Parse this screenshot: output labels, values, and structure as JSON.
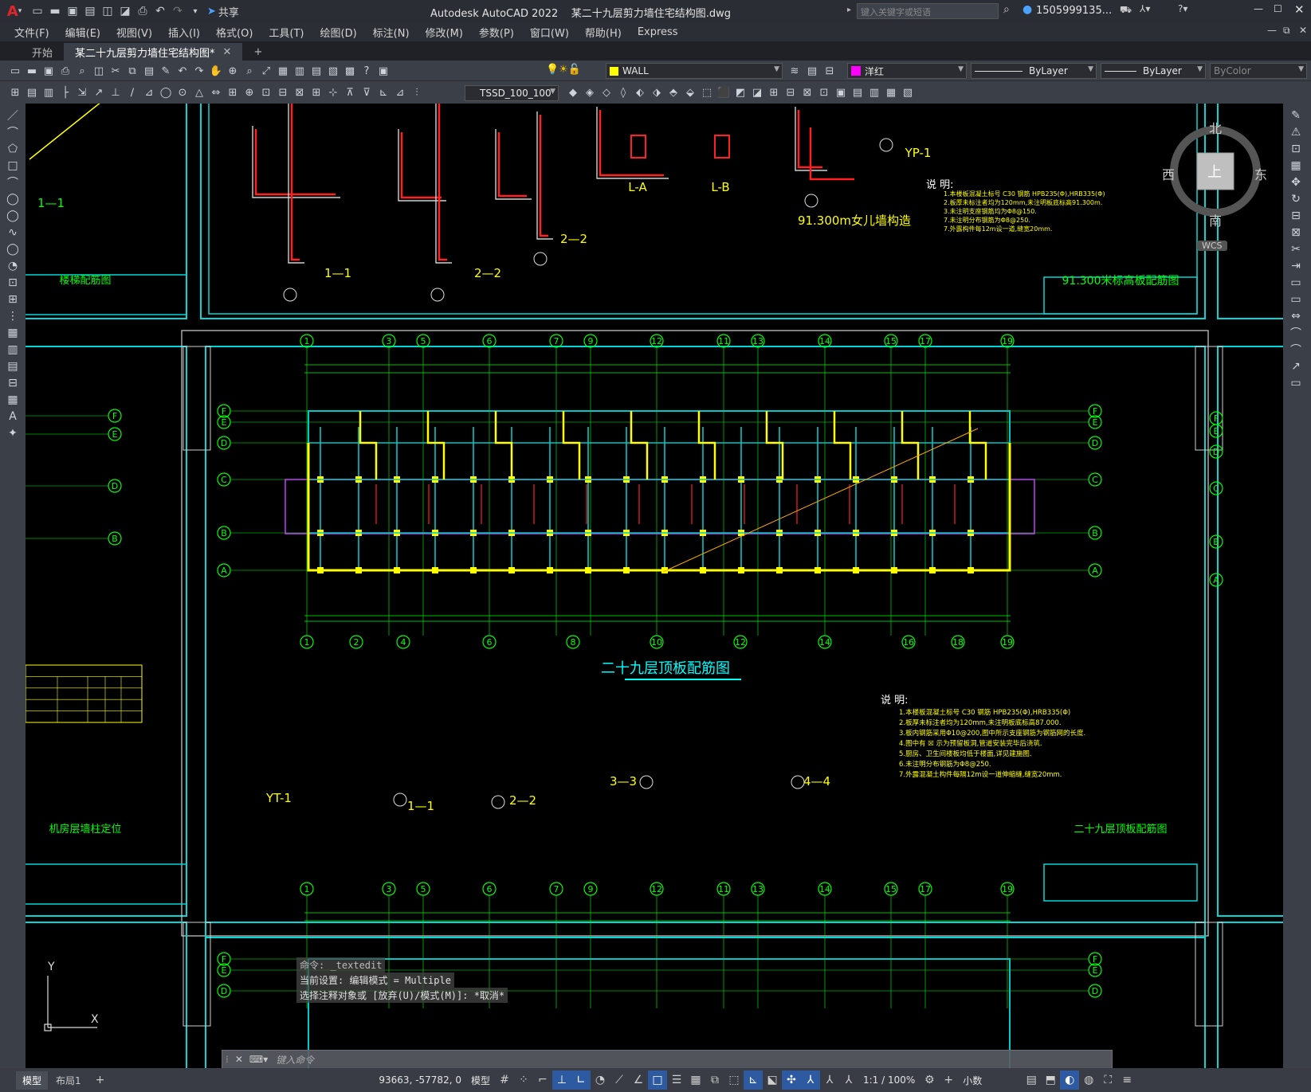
{
  "titlebar": {
    "app_title": "Autodesk AutoCAD 2022",
    "file_title": "某二十九层剪力墙住宅结构图.dwg",
    "search_placeholder": "键入关键字或短语",
    "user": "1505999135...",
    "share": "共享"
  },
  "menu": [
    "文件(F)",
    "编辑(E)",
    "视图(V)",
    "插入(I)",
    "格式(O)",
    "工具(T)",
    "绘图(D)",
    "标注(N)",
    "修改(M)",
    "参数(P)",
    "窗口(W)",
    "帮助(H)",
    "Express"
  ],
  "tabs": {
    "start": "开始",
    "doc": "某二十九层剪力墙住宅结构图*",
    "add": "+"
  },
  "toolbar1": {
    "layer_name": "WALL",
    "color_name": "洋红",
    "linetype": "ByLayer",
    "lineweight": "ByLayer",
    "plotstyle": "ByColor"
  },
  "toolbar2": {
    "dimstyle": "TSSD_100_100"
  },
  "viewcube": {
    "north": "北",
    "south": "南",
    "east": "东",
    "west": "西",
    "top": "上",
    "wcs": "WCS"
  },
  "drawing": {
    "stair_title": "楼梯配筋图",
    "stair_section": "1—1",
    "title_9130": "91.300米标高板配筋图",
    "parapet": "91.300m女儿墙构造",
    "note_head": "说 明:",
    "main_title": "二十九层顶板配筋图",
    "main_title_box": "二十九层顶板配筋图",
    "machine_room": "机房层墙柱定位",
    "sec_11": "1—1",
    "sec_22": "2—2",
    "sec_33": "3—3",
    "sec_44": "4—4",
    "yt1": "YT-1",
    "yp1": "YP-1",
    "la": "L-A",
    "lb": "L-B",
    "axis_top": [
      "1",
      "3",
      "5",
      "6",
      "7",
      "9",
      "12",
      "11",
      "13",
      "14",
      "15",
      "17",
      "19"
    ],
    "axis_bottom": [
      "1",
      "2",
      "4",
      "6",
      "8",
      "10",
      "12",
      "14",
      "16",
      "18",
      "19"
    ],
    "axis_rows": [
      "F",
      "E",
      "D",
      "C",
      "B",
      "A"
    ],
    "notes": [
      "1.本楼板混凝土标号 C30  钢筋 HPB235(Φ),HRB335(Φ)",
      "2.板厚未标注者均为120mm,未注明板底标高87.000.",
      "3.板内钢筋采用Φ10@200,图中所示支座钢筋为钢筋网的长度.",
      "4.图中有 ☒ 示为预留板洞,管道安装完毕后浇筑.",
      "5.厨房、卫生间楼板均低于楼面,详见建施图.",
      "6.未注明分布钢筋为Φ8@250.",
      "7.外露混凝土构件每隔12m设一道伸缩缝,缝宽20mm."
    ],
    "notes_top": [
      "1.本楼板混凝土标号 C30  钢筋 HPB235(Φ),HRB335(Φ)",
      "2.板厚未标注者均为120mm,未注明板底标高91.300m.",
      "3.未注明支座钢筋均为Φ8@150.",
      "7.未注明分布钢筋为Φ8@250.",
      "7.外露构件每12m设一道,缝宽20mm."
    ]
  },
  "command": {
    "line1": "命令: _textedit",
    "line2": "当前设置: 编辑模式 = Multiple",
    "line3": "选择注释对象或 [放弃(U)/模式(M)]: *取消*",
    "input_placeholder": "键入命令"
  },
  "status": {
    "model_tab": "模型",
    "layout_tab": "布局1",
    "add": "+",
    "coords": "93663, -57782, 0",
    "model": "模型",
    "scale": "1:1 / 100%",
    "units": "小数"
  },
  "ucs": {
    "y": "Y",
    "x": "X"
  }
}
